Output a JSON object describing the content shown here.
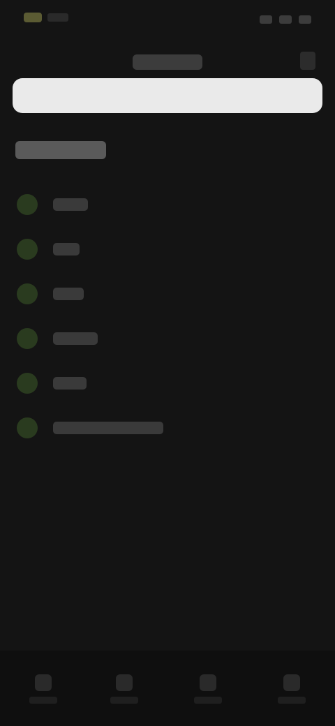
{
  "status_bar": {
    "left_items": [
      "status-time",
      "status-small"
    ],
    "right_items": [
      "signal-icon",
      "wifi-icon",
      "battery-icon"
    ]
  },
  "header": {
    "title": "",
    "action_icon": "more-icon"
  },
  "search": {
    "placeholder": ""
  },
  "section": {
    "title": ""
  },
  "list": {
    "items": [
      {
        "icon": "item-icon",
        "label": ""
      },
      {
        "icon": "item-icon",
        "label": ""
      },
      {
        "icon": "item-icon",
        "label": ""
      },
      {
        "icon": "item-icon",
        "label": ""
      },
      {
        "icon": "item-icon",
        "label": ""
      },
      {
        "icon": "item-icon",
        "label": ""
      }
    ]
  },
  "bottom_nav": {
    "items": [
      {
        "icon": "nav-icon",
        "label": ""
      },
      {
        "icon": "nav-icon",
        "label": ""
      },
      {
        "icon": "nav-icon",
        "label": ""
      },
      {
        "icon": "nav-icon",
        "label": ""
      }
    ]
  },
  "colors": {
    "background": "#141414",
    "search_bar": "#eaeaea",
    "accent_dot": "#2a3b1f"
  }
}
